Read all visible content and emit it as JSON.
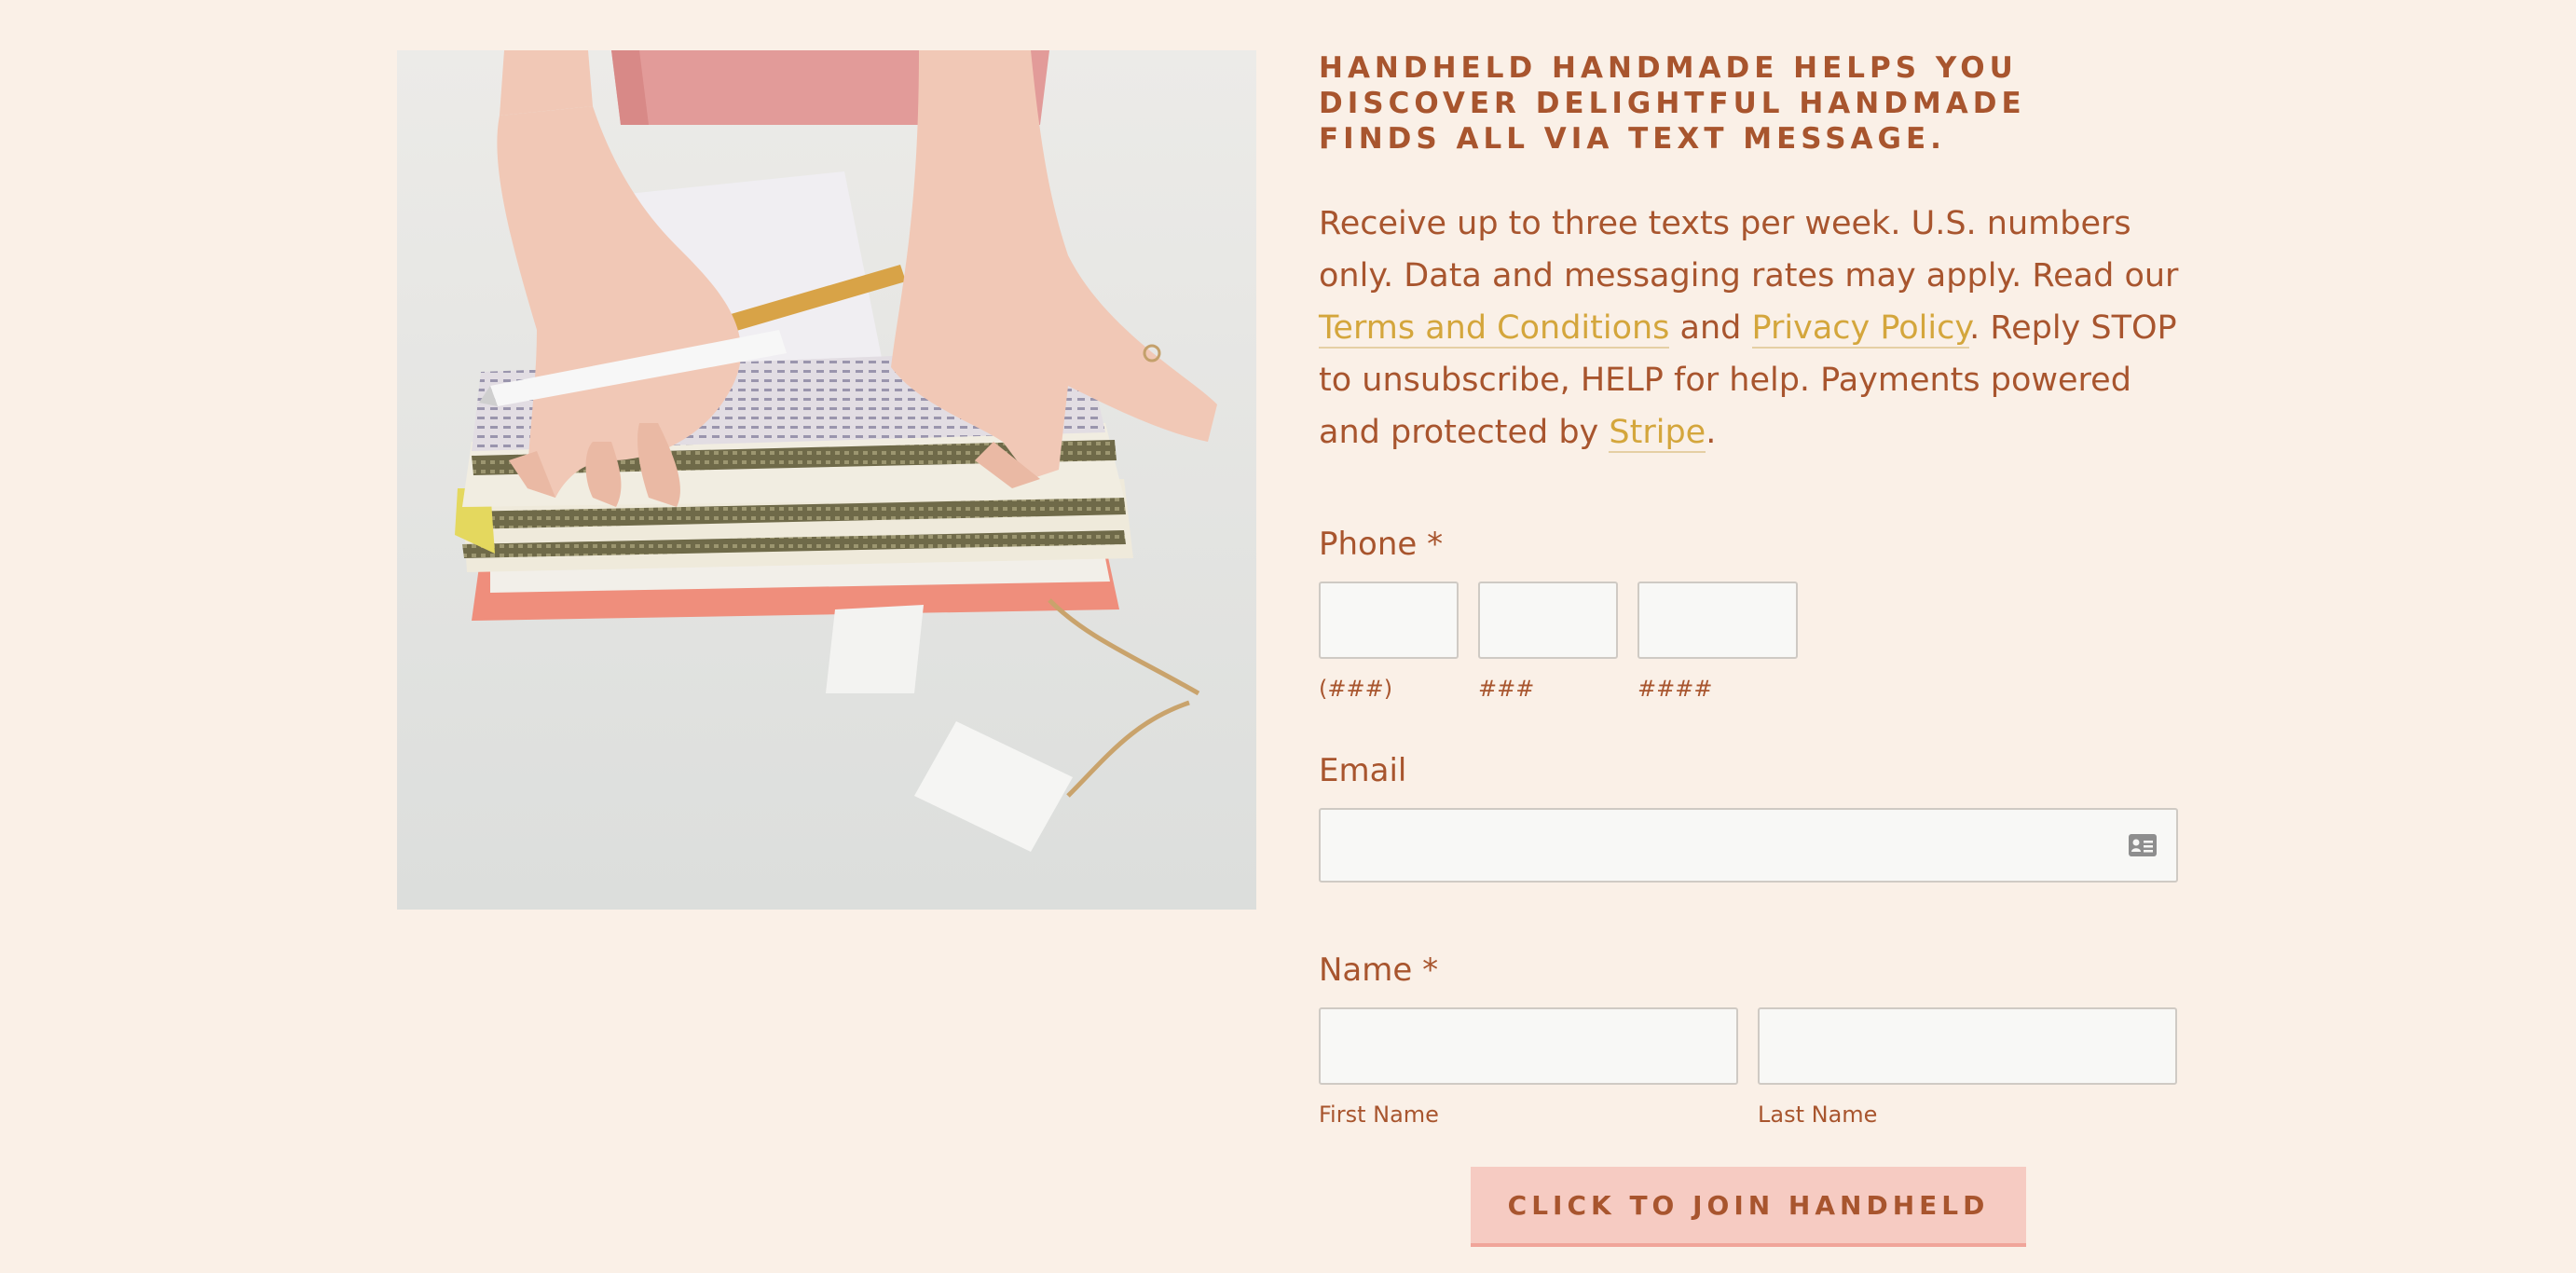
{
  "colors": {
    "background": "#faf0e7",
    "text": "#a8552e",
    "link": "#d4a63c",
    "button": "#f6cbc2",
    "button_border": "#f0a59a",
    "input_bg": "#f8f8f6"
  },
  "image": {
    "icon": "photo-hands-zipper-pouches"
  },
  "intro": {
    "headline": "HANDHELD HANDMADE HELPS YOU DISCOVER DELIGHTFUL HANDMADE FINDS ALL VIA TEXT MESSAGE.",
    "text_1": "Receive up to three texts per week. U.S. numbers only. Data and messaging rates may apply. Read our ",
    "link_terms": "Terms and Conditions",
    "text_2": " and ",
    "link_privacy": "Privacy Policy",
    "text_3": ". Reply STOP to unsubscribe, HELP for help. Payments powered and protected by ",
    "link_stripe": "Stripe",
    "text_4": "."
  },
  "form": {
    "phone": {
      "label": "Phone *",
      "area": {
        "value": "",
        "sub_label": "(###)"
      },
      "prefix": {
        "value": "",
        "sub_label": "###"
      },
      "line": {
        "value": "",
        "sub_label": "####"
      }
    },
    "email": {
      "label": "Email",
      "value": "",
      "icon": "contact-card-icon"
    },
    "name": {
      "label": "Name *",
      "first": {
        "value": "",
        "sub_label": "First Name"
      },
      "last": {
        "value": "",
        "sub_label": "Last Name"
      }
    },
    "submit_label": "CLICK TO JOIN HANDHELD"
  }
}
